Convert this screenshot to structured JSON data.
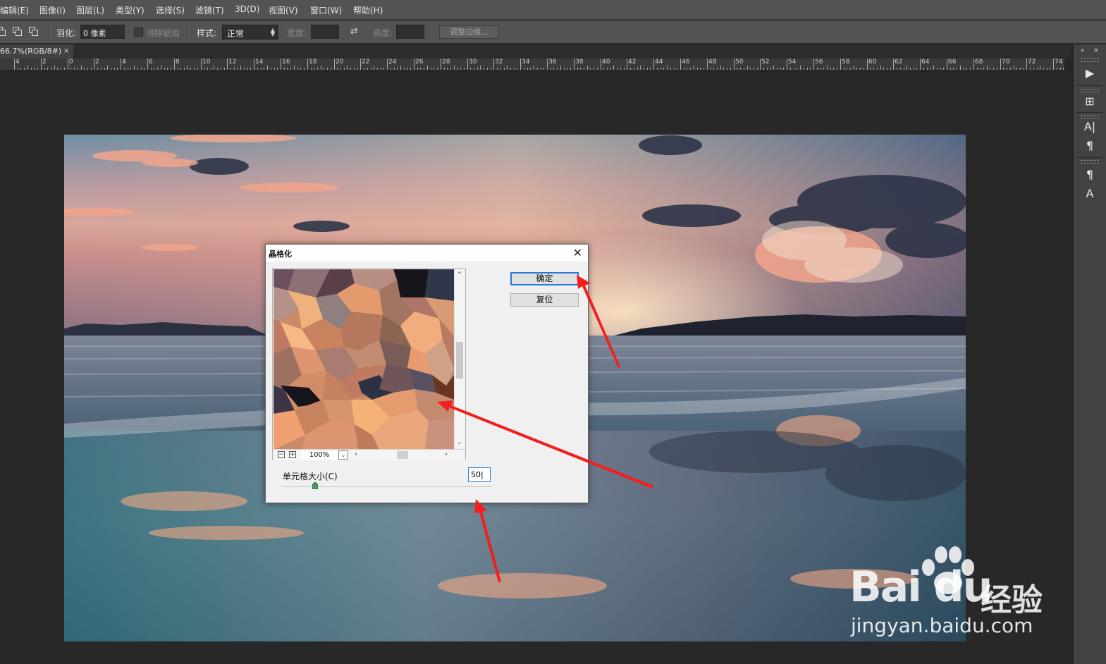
{
  "menu": [
    "编辑(E)",
    "图像(I)",
    "图层(L)",
    "类型(Y)",
    "选择(S)",
    "滤镜(T)",
    "3D(D)",
    "视图(V)",
    "窗口(W)",
    "帮助(H)"
  ],
  "options": {
    "feather_label": "羽化:",
    "feather_value": "0 像素",
    "antialias_label": "消除锯齿",
    "style_label": "样式:",
    "style_value": "正常",
    "width_label": "宽度:",
    "height_label": "高度:",
    "refine_edge_label": "调整边缘..."
  },
  "document_tab": {
    "title": "66.7%(RGB/8#)",
    "close": "×"
  },
  "ruler": {
    "labels": [
      "4",
      "2",
      "0",
      "2",
      "4",
      "6",
      "8",
      "10",
      "12",
      "14",
      "16",
      "18",
      "20",
      "22",
      "24",
      "26",
      "28",
      "30",
      "32",
      "34",
      "36",
      "38",
      "40",
      "42",
      "44",
      "46",
      "48",
      "50",
      "52",
      "54",
      "56",
      "58",
      "60",
      "62",
      "64",
      "66",
      "68",
      "70",
      "72",
      "74"
    ]
  },
  "panel": {
    "collapse_label": "»",
    "close_label": "×",
    "icons": [
      "play-icon",
      "info-icon",
      "character-icon",
      "paragraph-icon",
      "paragraph-style-icon",
      "character-style-icon"
    ],
    "glyphs": [
      "▶",
      "⊞",
      "A|",
      "¶",
      "¶",
      "A"
    ]
  },
  "dialog": {
    "title": "晶格化",
    "ok_label": "确定",
    "reset_label": "复位",
    "zoom_value": "100%",
    "cell_size_label": "单元格大小(C)",
    "cell_size_value": "50",
    "cell_size_slider_value": 50,
    "zoom_out": "−",
    "zoom_in": "+"
  },
  "watermark": {
    "logo_text": "Bai du",
    "cn_text": "经验",
    "url": "jingyan.baidu.com"
  },
  "colors": {
    "accent": "#2a7ad8",
    "annotation_arrow": "#f21f1f"
  }
}
